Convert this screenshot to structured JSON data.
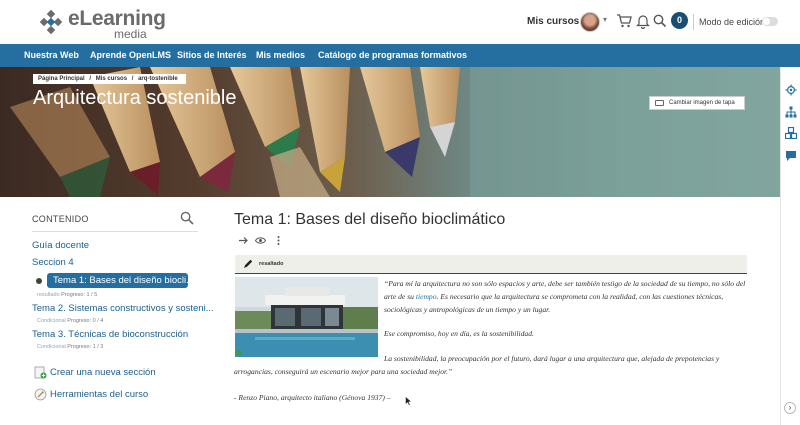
{
  "header": {
    "logo_main": "eLearning",
    "logo_sub": "media",
    "my_courses": "Mis cursos",
    "notifications_count": "0",
    "edit_mode_label": "Modo de edición"
  },
  "nav": {
    "items": [
      "Nuestra Web",
      "Aprende OpenLMS",
      "Sitios de Interés",
      "Mis medios",
      "Catálogo de programas formativos"
    ]
  },
  "hero": {
    "breadcrumb": [
      "Página Principal",
      "/",
      "Mis cursos",
      "/",
      "arq-tostenible"
    ],
    "title": "Arquitectura sostenible",
    "cover_button": "Cambiar imagen de tapa"
  },
  "sidebar": {
    "heading": "CONTENIDO",
    "items": [
      {
        "label": "Guía docente"
      },
      {
        "label": "Seccion 4"
      },
      {
        "label": "Tema 1: Bases del diseño biocli...",
        "meta_tag": "resultado",
        "meta_text": "Progreso: 1 / 5"
      },
      {
        "label": "Tema 2. Sistemas constructivos y sosteni...",
        "meta_tag": "Condicional",
        "meta_text": "Progreso: 0 / 4"
      },
      {
        "label": "Tema 3. Técnicas de bioconstrucción",
        "meta_tag": "Condicional",
        "meta_text": "Progreso: 1 / 3"
      }
    ],
    "tools": [
      {
        "label": "Crear una nueva sección"
      },
      {
        "label": "Herramientas del curso"
      }
    ]
  },
  "main": {
    "title": "Tema 1: Bases del diseño bioclimático",
    "tag_label": "resaltado",
    "quote_p1_a": "“Para mí la arquitectura no son sólo espacios y arte, debe ser también testigo de la sociedad de su tiempo, no sólo del arte de su ",
    "quote_p1_link": "tiempo",
    "quote_p1_b": ". Es necesario que la arquitectura se comprometa con la realidad, con las cuestiones técnicas, sociológicas y antropológicas de un tiempo y un lugar.",
    "quote_p2": "Ese compromiso, hoy en día, es la sostenibilidad.",
    "quote_p3": "La sostenibilidad, la preocupación por el futuro, dará lugar a una arquitectura que, alejada de prepotencias y arrogancias, conseguirá un escenario mejor para una sociedad mejor.”",
    "attribution": "- Renzo Piano, arquitecto italiano (Génova 1937) –"
  }
}
